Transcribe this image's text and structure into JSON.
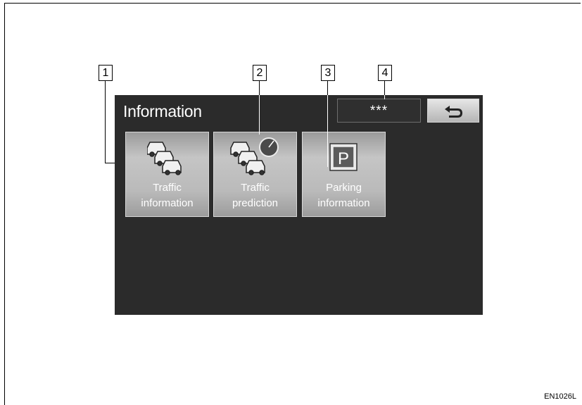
{
  "screen": {
    "title": "Information",
    "title_box": "***",
    "back_icon": "return-arrow-icon"
  },
  "menu": [
    {
      "line1": "Traffic",
      "line2": "information",
      "icon": "traffic-cars-icon"
    },
    {
      "line1": "Traffic",
      "line2": "prediction",
      "icon": "traffic-prediction-icon"
    },
    {
      "line1": "Parking",
      "line2": "information",
      "icon": "parking-icon"
    }
  ],
  "parking_letter": "P",
  "callouts": [
    "1",
    "2",
    "3",
    "4"
  ],
  "figure_code": "EN1026L",
  "colors": {
    "screen_bg": "#2b2b2b",
    "button_face": "#bababa",
    "text": "#ffffff"
  }
}
